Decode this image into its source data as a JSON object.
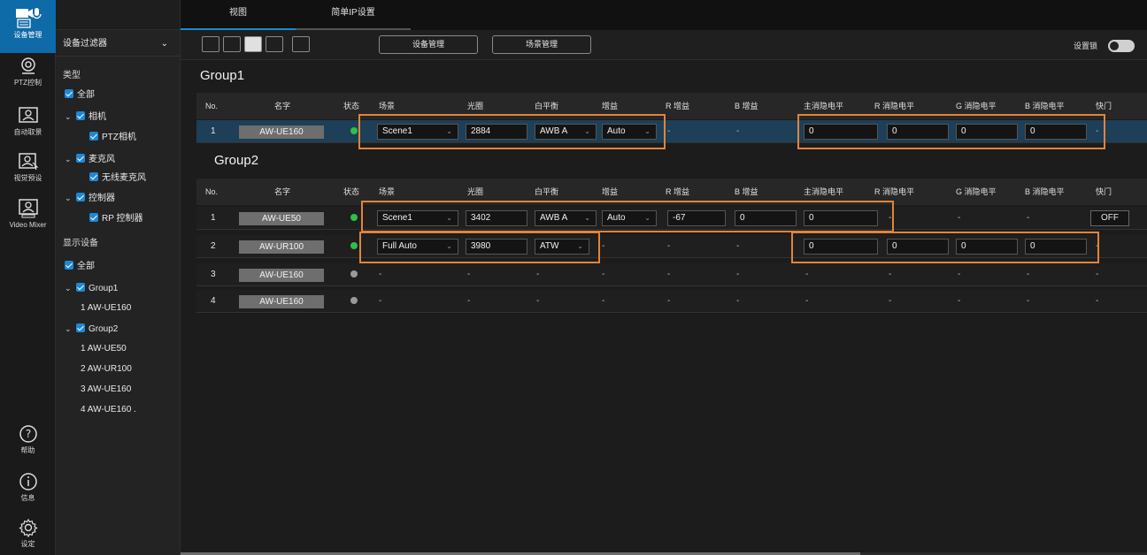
{
  "rail": {
    "items": [
      {
        "label": "设备管理",
        "icon": "camera-mic-icon"
      },
      {
        "label": "PTZ控制",
        "icon": "ptz-icon"
      },
      {
        "label": "自动取景",
        "icon": "auto-framing-icon"
      },
      {
        "label": "视觉预设",
        "icon": "visual-preset-icon"
      },
      {
        "label": "Video Mixer",
        "icon": "video-mixer-icon"
      },
      {
        "label": "帮助",
        "icon": "help-icon"
      },
      {
        "label": "信息",
        "icon": "info-icon"
      },
      {
        "label": "设定",
        "icon": "gear-icon"
      }
    ]
  },
  "tabs": {
    "view": "视图",
    "ip": "简单IP设置"
  },
  "sidebar": {
    "filter_label": "设备过滤器",
    "type_heading": "类型",
    "display_heading": "显示设备",
    "type_items": {
      "all": "全部",
      "camera": "相机",
      "ptz_camera": "PTZ相机",
      "mic": "麦克风",
      "wireless_mic": "无线麦克风",
      "controller": "控制器",
      "rp_controller": "RP 控制器"
    },
    "display_items": {
      "all": "全部",
      "group1": "Group1",
      "g1_dev1": "1  AW-UE160",
      "group2": "Group2",
      "g2_dev1": "1  AW-UE50",
      "g2_dev2": "2  AW-UR100",
      "g2_dev3": "3  AW-UE160",
      "g2_dev4": "4  AW-UE160 ."
    }
  },
  "toolbar": {
    "device_mgmt": "设备管理",
    "scene_mgmt": "场景管理",
    "lock_label": "设置锁"
  },
  "headers": {
    "no": "No.",
    "name": "名字",
    "status": "状态",
    "scene": "场景",
    "iris": "光圈",
    "wb": "白平衡",
    "gain": "增益",
    "rgain": "R 增益",
    "bgain": "B 增益",
    "master_ped": "主消隐电平",
    "r_ped": "R 消隐电平",
    "g_ped": "G 消隐电平",
    "b_ped": "B 消隐电平",
    "shutter": "快门"
  },
  "groups": [
    {
      "title": "Group1",
      "rows": [
        {
          "no": "1",
          "name": "AW-UE160",
          "status": "online",
          "scene": "Scene1",
          "iris": "2884",
          "wb": "AWB A",
          "gain": "Auto",
          "rgain": "-",
          "bgain": "-",
          "master_ped": "0",
          "r_ped": "0",
          "g_ped": "0",
          "b_ped": "0",
          "shutter": "-"
        }
      ]
    },
    {
      "title": "Group2",
      "rows": [
        {
          "no": "1",
          "name": "AW-UE50",
          "status": "online",
          "scene": "Scene1",
          "iris": "3402",
          "wb": "AWB A",
          "gain": "Auto",
          "rgain": "-67",
          "bgain": "0",
          "master_ped": "0",
          "r_ped": "-",
          "g_ped": "-",
          "b_ped": "-",
          "shutter": "OFF"
        },
        {
          "no": "2",
          "name": "AW-UR100",
          "status": "online",
          "scene": "Full Auto",
          "iris": "3980",
          "wb": "ATW",
          "gain": "-",
          "rgain": "-",
          "bgain": "-",
          "master_ped": "0",
          "r_ped": "0",
          "g_ped": "0",
          "b_ped": "0",
          "shutter": "-"
        },
        {
          "no": "3",
          "name": "AW-UE160",
          "status": "offline",
          "scene": "-",
          "iris": "-",
          "wb": "-",
          "gain": "-",
          "rgain": "-",
          "bgain": "-",
          "master_ped": "-",
          "r_ped": "-",
          "g_ped": "-",
          "b_ped": "-",
          "shutter": "-"
        },
        {
          "no": "4",
          "name": "AW-UE160",
          "status": "offline",
          "scene": "-",
          "iris": "-",
          "wb": "-",
          "gain": "-",
          "rgain": "-",
          "bgain": "-",
          "master_ped": "-",
          "r_ped": "-",
          "g_ped": "-",
          "b_ped": "-",
          "shutter": "-"
        }
      ]
    }
  ],
  "colors": {
    "accent": "#1e88d6",
    "online": "#2fbf4a",
    "offline": "#9a9a9a",
    "highlight": "#e2843a",
    "selected_row": "#1d3f58"
  }
}
